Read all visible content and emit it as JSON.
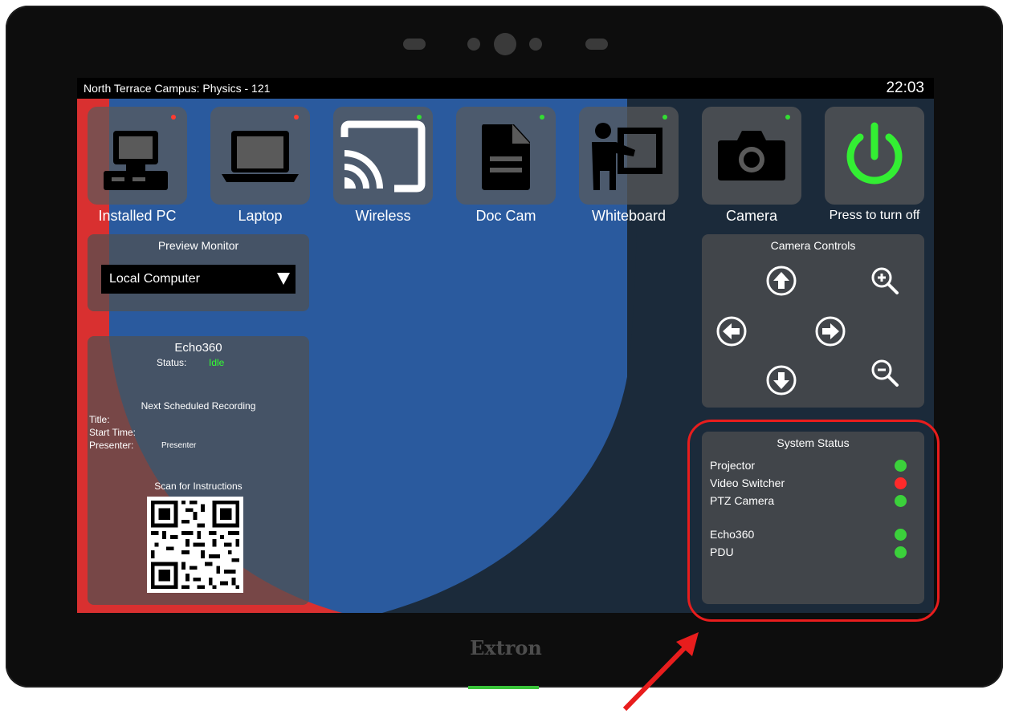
{
  "header": {
    "room": "North Terrace Campus: Physics - 121",
    "clock": "22:03"
  },
  "brand": "Extron",
  "sources": [
    {
      "label": "Installed PC",
      "icon": "desktop-computer-icon",
      "indicator": "#ff3b30"
    },
    {
      "label": "Laptop",
      "icon": "laptop-icon",
      "indicator": "#ff3b30"
    },
    {
      "label": "Wireless",
      "icon": "cast-icon",
      "indicator": "#33dd33"
    },
    {
      "label": "Doc Cam",
      "icon": "document-icon",
      "indicator": "#33dd33"
    },
    {
      "label": "Whiteboard",
      "icon": "presenter-whiteboard-icon",
      "indicator": "#33dd33"
    },
    {
      "label": "Camera",
      "icon": "camera-icon",
      "indicator": "#33dd33"
    },
    {
      "label": "Press to turn off",
      "icon": "power-icon"
    }
  ],
  "preview": {
    "title": "Preview Monitor",
    "selected": "Local Computer"
  },
  "echo": {
    "title": "Echo360",
    "status_label": "Status:",
    "status_value": "Idle",
    "next_title": "Next Scheduled Recording",
    "title_label": "Title:",
    "start_label": "Start Time:",
    "presenter_label": "Presenter:",
    "presenter_value": "Presenter",
    "scan_label": "Scan for Instructions"
  },
  "camera_controls": {
    "title": "Camera Controls"
  },
  "system_status": {
    "title": "System Status",
    "items": [
      {
        "name": "Projector",
        "color": "#3bd13b"
      },
      {
        "name": "Video Switcher",
        "color": "#ff2a2a"
      },
      {
        "name": "PTZ Camera",
        "color": "#3bd13b"
      },
      {
        "name": "Echo360",
        "color": "#3bd13b"
      },
      {
        "name": "PDU",
        "color": "#3bd13b"
      }
    ]
  },
  "colors": {
    "accent_green": "#33ee33",
    "status_idle": "#33ff33",
    "annotation_red": "#e81d1d",
    "bg_blue": "#2a5a9e"
  }
}
